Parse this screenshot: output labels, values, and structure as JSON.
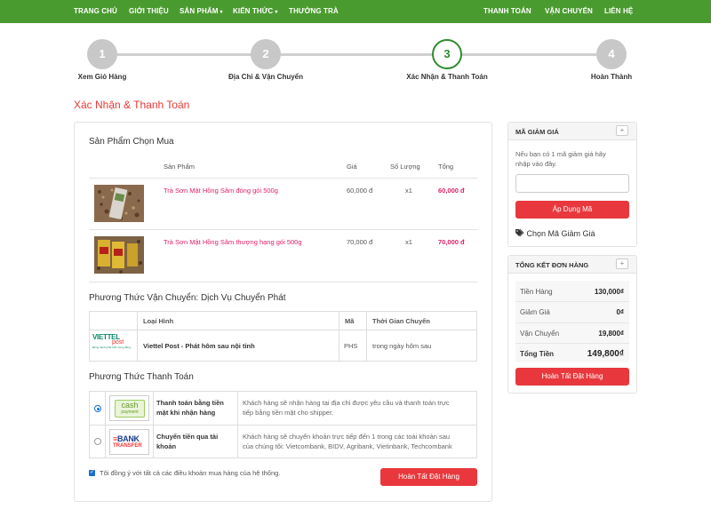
{
  "nav": {
    "left": [
      "TRANG CHỦ",
      "GIỚI THIỆU",
      "SẢN PHẨM",
      "KIẾN THỨC",
      "THƯỞNG TRÀ"
    ],
    "right": [
      "THANH TOÁN",
      "VẬN CHUYỂN",
      "LIÊN HỆ"
    ],
    "caret": "▾"
  },
  "steps": [
    {
      "num": "1",
      "label": "Xem Giỏ Hàng"
    },
    {
      "num": "2",
      "label": "Địa Chỉ & Vận Chuyển"
    },
    {
      "num": "3",
      "label": "Xác Nhận & Thanh Toán"
    },
    {
      "num": "4",
      "label": "Hoàn Thành"
    }
  ],
  "page_title": "Xác Nhận & Thanh Toán",
  "products": {
    "title": "Sản Phẩm Chọn Mua",
    "headers": [
      "Sản Phẩm",
      "Giá",
      "Số Lượng",
      "Tổng"
    ],
    "rows": [
      {
        "name": "Trà Sơn Mật Hồng Sâm đóng gói 500g",
        "price": "60,000 đ",
        "qty": "x1",
        "total": "60,000 đ"
      },
      {
        "name": "Trà Sơn Mật Hồng Sâm thượng hạng gói 500g",
        "price": "70,000 đ",
        "qty": "x1",
        "total": "70,000 đ"
      }
    ]
  },
  "shipping": {
    "title": "Phương Thức Vận Chuyển: Dịch Vụ Chuyển Phát",
    "headers": [
      "Loại Hình",
      "Mã",
      "Thời Gian Chuyển"
    ],
    "logo_text": "VIETTEL",
    "logo_sub": "post",
    "logo_tag": "Đồng hành phát triển cộng đồng",
    "row": {
      "name": "Viettel Post - Phát hôm sau nội tỉnh",
      "code": "PHS",
      "time": "trong ngày hôm sau"
    }
  },
  "payment": {
    "title": "Phương Thức Thanh Toán",
    "methods": [
      {
        "logo_line1": "cash",
        "logo_line2": "payment",
        "name_line1": "Thanh toán bằng tiền",
        "name_line2": "mặt khi nhận hàng",
        "desc_line1": "Khách hàng sẽ nhận hàng tại địa chỉ được yêu cầu và thanh toán trực",
        "desc_line2": "tiếp bằng tiền mặt cho shipper.",
        "selected": true
      },
      {
        "logo_line1": "BANK",
        "logo_line2": "TRANSFER",
        "name_line1": "Chuyển tiền qua tài",
        "name_line2": "khoản",
        "desc_line1": "Khách hàng sẽ chuyển khoản trực tiếp đến 1 trong các toài khoản sau",
        "desc_line2": "của chúng tôi: Vietcombank, BIDV, Agribank, Vietinbank, Techcombank",
        "selected": false
      }
    ]
  },
  "agree_text": "Tôi đồng ý với tất cả các điều khoản mua hàng của hệ thống.",
  "complete_button": "Hoàn Tất Đặt Hàng",
  "coupon": {
    "title": "MÃ GIẢM GIÁ",
    "plus": "+",
    "desc_line1": "Nếu bạn có 1 mã giảm giá hãy",
    "desc_line2": "nhập vào đây.",
    "input_value": "",
    "apply_button": "Áp Dụng Mã",
    "choose_link": "Chọn Mã Giảm Giá"
  },
  "summary": {
    "title": "TỔNG KẾT ĐƠN HÀNG",
    "plus": "+",
    "rows": [
      {
        "label": "Tiền Hàng",
        "value": "130,000₫"
      },
      {
        "label": "Giảm Giá",
        "value": "0₫"
      },
      {
        "label": "Vận Chuyển",
        "value": "19,800₫"
      },
      {
        "label": "Tổng Tiền",
        "value": "149,800₫"
      }
    ],
    "button": "Hoàn Tất Đặt Hàng"
  },
  "colors": {
    "nav": "#4a9b2f",
    "accent_red": "#e8383d",
    "link_pink": "#e0206a",
    "step_active": "#2e8b2e"
  }
}
